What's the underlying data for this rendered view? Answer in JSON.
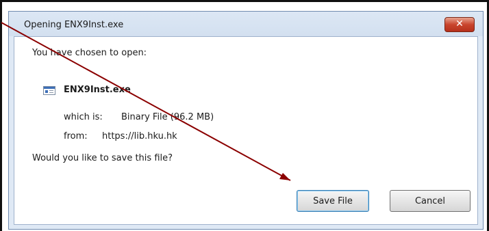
{
  "dialog": {
    "title": "Opening ENX9Inst.exe",
    "close_symbol": "✕",
    "intro": "You have chosen to open:",
    "file": {
      "icon": "application-file-icon",
      "name": "ENX9Inst.exe",
      "type_label": "which is:",
      "type_value": "Binary File (96.2 MB)",
      "from_label": "from:",
      "from_value": "https://lib.hku.hk"
    },
    "question": "Would you like to save this file?",
    "buttons": {
      "save": "Save File",
      "cancel": "Cancel"
    }
  },
  "annotation": {
    "type": "arrow",
    "color": "#8b0000"
  }
}
